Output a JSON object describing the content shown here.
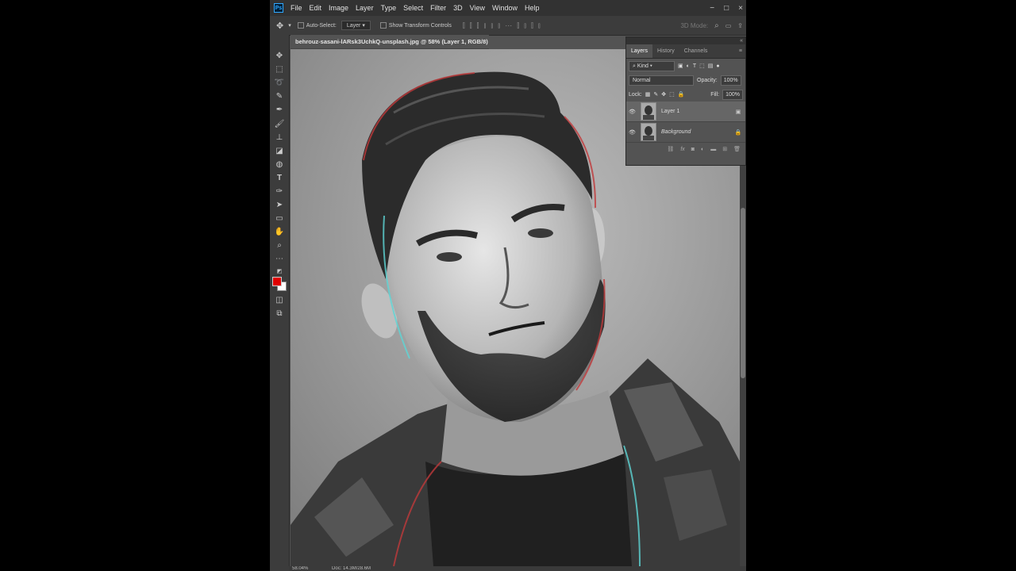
{
  "menubar": {
    "app_icon": "Ps",
    "items": [
      "File",
      "Edit",
      "Image",
      "Layer",
      "Type",
      "Select",
      "Filter",
      "3D",
      "View",
      "Window",
      "Help"
    ],
    "window_controls": [
      "−",
      "□",
      "×"
    ]
  },
  "options_bar": {
    "auto_select_label": "Auto-Select:",
    "auto_select_target": "Layer",
    "show_transform_label": "Show Transform Controls",
    "mode_3d_label": "3D Mode:"
  },
  "document": {
    "tab_title": "behrouz-sasani-lARsk3UchkQ-unsplash.jpg @ 58% (Layer 1, RGB/8)"
  },
  "status": {
    "zoom": "58.04%",
    "doc_size": "Doc: 14.3M/28.6M"
  },
  "colors": {
    "foreground": "#e00000",
    "background": "#ffffff",
    "app_bg": "#535353"
  },
  "layers_panel": {
    "tabs": [
      "Layers",
      "History",
      "Channels"
    ],
    "filter_label": "Kind",
    "blend_mode": "Normal",
    "opacity_label": "Opacity:",
    "opacity_value": "100%",
    "lock_label": "Lock:",
    "fill_label": "Fill:",
    "fill_value": "100%",
    "layers": [
      {
        "name": "Layer 1",
        "selected": true
      },
      {
        "name": "Background",
        "selected": false
      }
    ]
  }
}
